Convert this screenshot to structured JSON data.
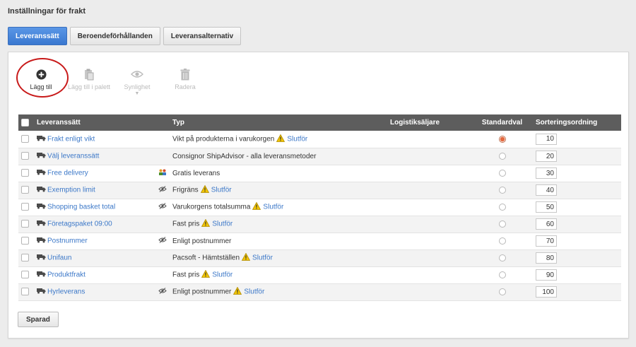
{
  "page": {
    "title": "Inställningar för frakt"
  },
  "tabs": [
    {
      "label": "Leveranssätt",
      "active": true
    },
    {
      "label": "Beroendeförhållanden",
      "active": false
    },
    {
      "label": "Leveransalternativ",
      "active": false
    }
  ],
  "toolbar": {
    "add_label": "Lägg till",
    "add_palette_label": "Lägg till i palett",
    "visibility_label": "Synlighet",
    "delete_label": "Radera"
  },
  "table": {
    "headers": {
      "name": "Leveranssätt",
      "type": "Typ",
      "logistics": "Logistiksäljare",
      "default": "Standardval",
      "sort": "Sorteringsordning"
    },
    "rows": [
      {
        "name": "Frakt enligt vikt",
        "side_icon": "",
        "type": "Vikt på produkterna i varukorgen",
        "warn": true,
        "finish": "Slutför",
        "default": true,
        "sort": "10"
      },
      {
        "name": "Välj leveranssätt",
        "side_icon": "",
        "type": "Consignor ShipAdvisor - alla leveransmetoder",
        "warn": false,
        "finish": "",
        "default": false,
        "sort": "20"
      },
      {
        "name": "Free delivery",
        "side_icon": "people-icon",
        "type": "Gratis leverans",
        "warn": false,
        "finish": "",
        "default": false,
        "sort": "30"
      },
      {
        "name": "Exemption limit",
        "side_icon": "hidden-eye-icon",
        "type": "Frigräns",
        "warn": true,
        "finish": "Slutför",
        "default": false,
        "sort": "40"
      },
      {
        "name": "Shopping basket total",
        "side_icon": "hidden-eye-icon",
        "type": "Varukorgens totalsumma",
        "warn": true,
        "finish": "Slutför",
        "default": false,
        "sort": "50"
      },
      {
        "name": "Företagspaket 09:00",
        "side_icon": "",
        "type": "Fast pris",
        "warn": true,
        "finish": "Slutför",
        "default": false,
        "sort": "60"
      },
      {
        "name": "Postnummer",
        "side_icon": "hidden-eye-icon",
        "type": "Enligt postnummer",
        "warn": false,
        "finish": "",
        "default": false,
        "sort": "70"
      },
      {
        "name": "Unifaun",
        "side_icon": "",
        "type": "Pacsoft - Hämtställen",
        "warn": true,
        "finish": "Slutför",
        "default": false,
        "sort": "80"
      },
      {
        "name": "Produktfrakt",
        "side_icon": "",
        "type": "Fast pris",
        "warn": true,
        "finish": "Slutför",
        "default": false,
        "sort": "90"
      },
      {
        "name": "Hyrleverans",
        "side_icon": "hidden-eye-icon",
        "type": "Enligt postnummer",
        "warn": true,
        "finish": "Slutför",
        "default": false,
        "sort": "100"
      }
    ]
  },
  "save_button": "Sparad",
  "colors": {
    "accent": "#3a78d0",
    "link": "#3c78c8",
    "warning": "#f2c500",
    "highlight_circle": "#c81a1a",
    "header": "#5d5d5d"
  }
}
